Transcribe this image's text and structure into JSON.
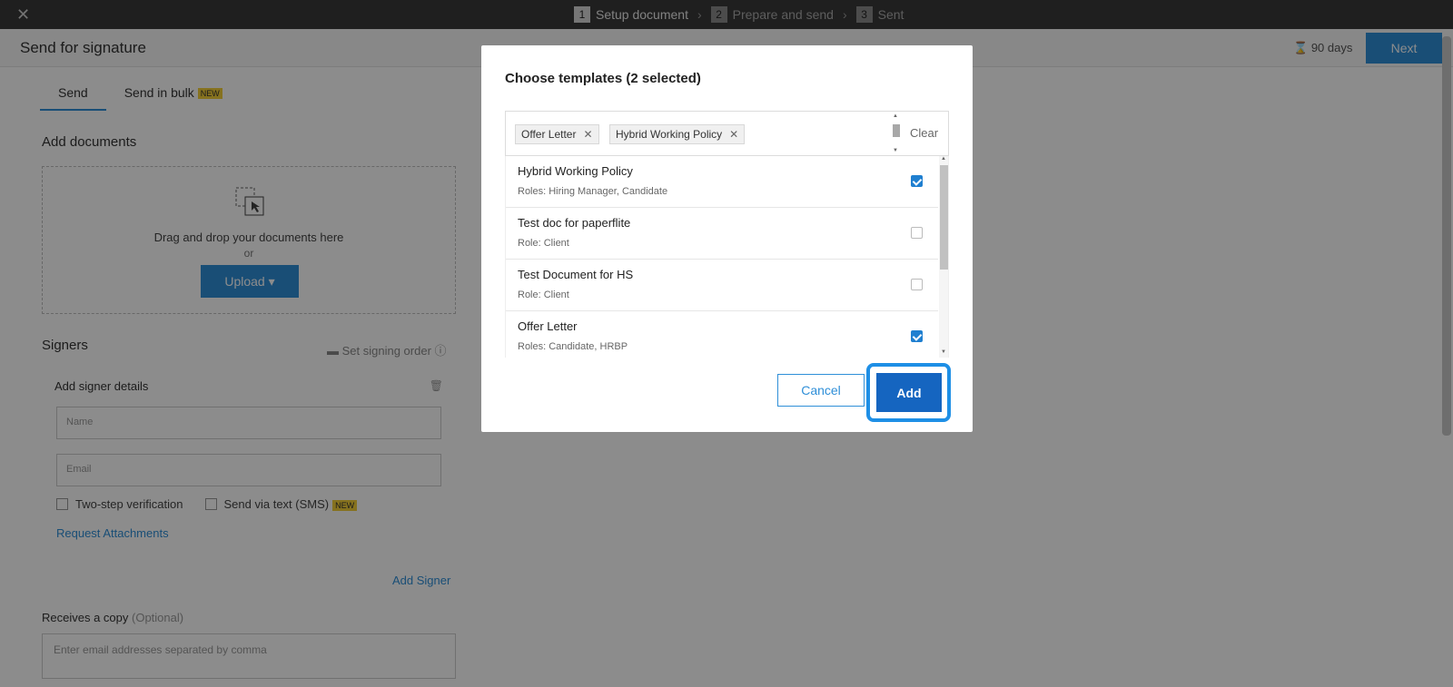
{
  "topbar": {
    "steps": [
      {
        "num": "1",
        "label": "Setup document"
      },
      {
        "num": "2",
        "label": "Prepare and send"
      },
      {
        "num": "3",
        "label": "Sent"
      }
    ]
  },
  "header": {
    "title": "Send for signature",
    "expiry": "90 days",
    "next_label": "Next"
  },
  "tabs": [
    {
      "label": "Send"
    },
    {
      "label": "Send in bulk",
      "badge": "NEW"
    }
  ],
  "documents": {
    "label": "Add documents",
    "drop_text": "Drag and drop your documents here",
    "or_text": "or",
    "upload_label": "Upload ▾"
  },
  "signers": {
    "label": "Signers",
    "signing_order": "Set signing order",
    "add_signer_details": "Add signer details",
    "name_placeholder": "Name",
    "email_placeholder": "Email",
    "two_step": "Two-step verification",
    "sms": "Send via text (SMS)",
    "sms_badge": "NEW",
    "request_attachments": "Request Attachments",
    "add_signer": "Add Signer"
  },
  "copy": {
    "label": "Receives a copy",
    "optional": "(Optional)",
    "placeholder": "Enter email addresses separated by comma"
  },
  "modal": {
    "title": "Choose templates (2 selected)",
    "chips": [
      "Offer Letter",
      "Hybrid Working Policy"
    ],
    "clear_label": "Clear",
    "items": [
      {
        "name": "Hybrid Working Policy",
        "roles": "Roles: Hiring Manager,  Candidate",
        "checked": true
      },
      {
        "name": "Test doc for paperflite",
        "roles": "Role: Client",
        "checked": false
      },
      {
        "name": "Test Document for HS",
        "roles": "Role: Client",
        "checked": false
      },
      {
        "name": "Offer Letter",
        "roles": "Roles: Candidate,  HRBP",
        "checked": true
      }
    ],
    "cancel_label": "Cancel",
    "add_label": "Add"
  }
}
